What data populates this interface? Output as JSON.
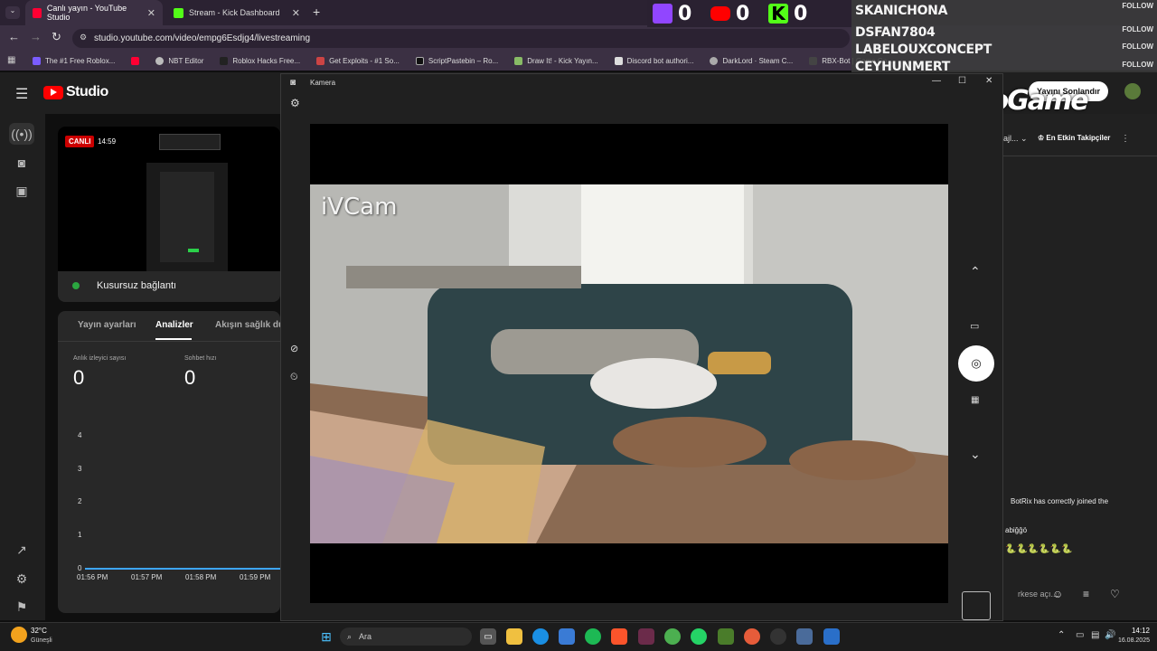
{
  "browser": {
    "tabs": [
      {
        "label": "Canlı yayın - YouTube Studio",
        "active": true
      },
      {
        "label": "Stream - Kick Dashboard",
        "active": false
      }
    ],
    "address": "studio.youtube.com/video/empg6Esdjg4/livestreaming",
    "bookmarks": [
      "The #1 Free Roblox...",
      "NBT Editor",
      "Roblox Hacks Free...",
      "Get Exploits - #1 So...",
      "ScriptPastebin – Ro...",
      "Draw It! - Kick Yayın...",
      "Discord bot authori...",
      "DarkLord · Steam C...",
      "RBX-Bot | Game Co..."
    ]
  },
  "overlay": {
    "counts": {
      "twitch": "0",
      "youtube": "0",
      "kick": "0"
    },
    "followers": [
      {
        "name": "SKANICHONA",
        "tag": "FOLLOW"
      },
      {
        "name": "DSFAN7804",
        "tag": "FOLLOW"
      },
      {
        "name": "LABELOUXCONCEPT",
        "tag": "FOLLOW"
      },
      {
        "name": "CEYHUNMERT",
        "tag": "FOLLOW"
      }
    ],
    "branding": "ByNoGame"
  },
  "studio": {
    "logo": "Studio",
    "live_badge": "CANLI",
    "live_time": "14:59",
    "connection": "Kusursuz bağlantı",
    "tabs": [
      "Yayın ayarları",
      "Analizler",
      "Akışın sağlık du"
    ],
    "metric1": {
      "label": "Anlık izleyici sayısı",
      "value": "0"
    },
    "metric2": {
      "label": "Sohbet hızı",
      "value": "0"
    },
    "y_ticks": [
      "4",
      "3",
      "2",
      "1",
      "0"
    ],
    "x_ticks": [
      "01:56 PM",
      "01:57 PM",
      "01:58 PM",
      "01:59 PM"
    ],
    "end_stream": "Yayını Sonlandır",
    "chat_filter": "En Etkin Takipçiler",
    "chat_msg1": "BotRix has correctly joined the",
    "chat_msg2": "abiğğö",
    "chat_placeholder": "rkese açı..."
  },
  "camera": {
    "title": "Kamera",
    "watermark": "iVCam"
  },
  "taskbar": {
    "weather_temp": "32°C",
    "weather_desc": "Güneşli",
    "search": "Ara",
    "time": "14:12",
    "date": "16.08.2025"
  }
}
